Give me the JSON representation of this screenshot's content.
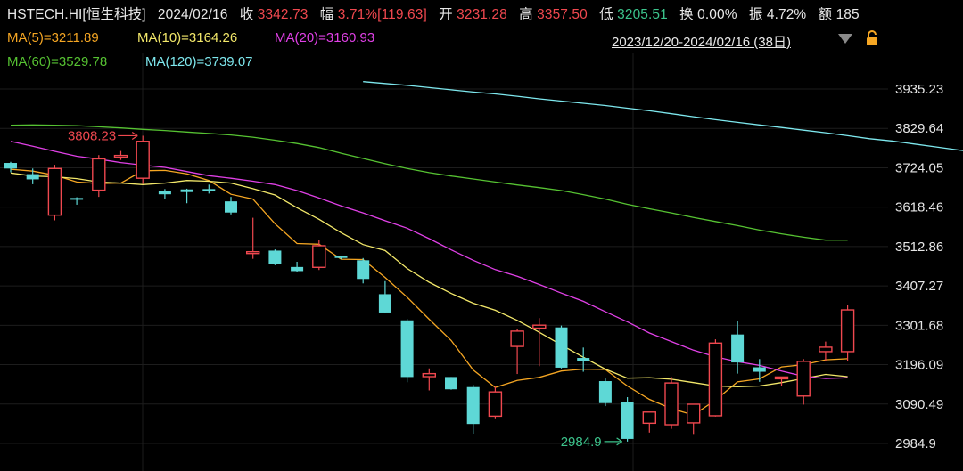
{
  "header": {
    "symbol": "HSTECH.HI[恒生科技]",
    "date": "2024/02/16",
    "close_label": "收",
    "close_value": "3342.73",
    "amp_label": "幅",
    "amp_value": "3.71%[119.63]",
    "open_label": "开",
    "open_value": "3231.28",
    "high_label": "高",
    "high_value": "3357.50",
    "low_label": "低",
    "low_value": "3205.51",
    "turnover_label": "换",
    "turnover_value": "0.00%",
    "swing_label": "振",
    "swing_value": "4.72%",
    "amount_label": "额",
    "amount_value": "185"
  },
  "indicators": {
    "ma5": "MA(5)=3211.89",
    "ma10": "MA(10)=3164.26",
    "ma20": "MA(20)=3160.93",
    "ma60": "MA(60)=3529.78",
    "ma120": "MA(120)=3739.07"
  },
  "range_label": "2023/12/20-2024/02/16 (38日)",
  "icons": [
    "dropdown-triangle-icon",
    "lock-icon"
  ],
  "colors": {
    "up": "#f0484f",
    "down": "#5ed8d6",
    "ma5": "#f5a623",
    "ma10": "#f3e86a",
    "ma20": "#e040e6",
    "ma60": "#56c232",
    "ma120": "#7ee8ee"
  },
  "chart_data": {
    "type": "candlestick",
    "y_ticks": [
      "3935.23",
      "3829.64",
      "3724.05",
      "3618.46",
      "3512.86",
      "3407.27",
      "3301.68",
      "3196.09",
      "3090.49",
      "2984.9"
    ],
    "ylim": [
      2960,
      3960
    ],
    "annotations": {
      "high_mark": "3808.23",
      "low_mark": "2984.9"
    },
    "candles": [
      {
        "o": 3737,
        "h": 3740,
        "l": 3712,
        "c": 3722
      },
      {
        "o": 3707,
        "h": 3722,
        "l": 3680,
        "c": 3693
      },
      {
        "o": 3597,
        "h": 3732,
        "l": 3583,
        "c": 3722
      },
      {
        "o": 3643,
        "h": 3645,
        "l": 3625,
        "c": 3642
      },
      {
        "o": 3664,
        "h": 3758,
        "l": 3646,
        "c": 3748
      },
      {
        "o": 3757,
        "h": 3769,
        "l": 3745,
        "c": 3757
      },
      {
        "o": 3696,
        "h": 3810,
        "l": 3681,
        "c": 3795
      },
      {
        "o": 3661,
        "h": 3667,
        "l": 3640,
        "c": 3653
      },
      {
        "o": 3666,
        "h": 3668,
        "l": 3629,
        "c": 3659
      },
      {
        "o": 3667,
        "h": 3679,
        "l": 3655,
        "c": 3662
      },
      {
        "o": 3634,
        "h": 3646,
        "l": 3599,
        "c": 3604
      },
      {
        "o": 3495,
        "h": 3590,
        "l": 3480,
        "c": 3499
      },
      {
        "o": 3502,
        "h": 3505,
        "l": 3463,
        "c": 3467
      },
      {
        "o": 3458,
        "h": 3472,
        "l": 3445,
        "c": 3447
      },
      {
        "o": 3457,
        "h": 3531,
        "l": 3450,
        "c": 3515
      },
      {
        "o": 3487,
        "h": 3488,
        "l": 3479,
        "c": 3486
      },
      {
        "o": 3476,
        "h": 3482,
        "l": 3414,
        "c": 3426
      },
      {
        "o": 3385,
        "h": 3420,
        "l": 3336,
        "c": 3336
      },
      {
        "o": 3315,
        "h": 3319,
        "l": 3149,
        "c": 3163
      },
      {
        "o": 3164,
        "h": 3186,
        "l": 3127,
        "c": 3172
      },
      {
        "o": 3163,
        "h": 3163,
        "l": 3129,
        "c": 3130
      },
      {
        "o": 3136,
        "h": 3142,
        "l": 3011,
        "c": 3037
      },
      {
        "o": 3058,
        "h": 3137,
        "l": 3050,
        "c": 3123
      },
      {
        "o": 3245,
        "h": 3292,
        "l": 3171,
        "c": 3286
      },
      {
        "o": 3294,
        "h": 3321,
        "l": 3192,
        "c": 3302
      },
      {
        "o": 3296,
        "h": 3301,
        "l": 3186,
        "c": 3188
      },
      {
        "o": 3214,
        "h": 3242,
        "l": 3177,
        "c": 3206
      },
      {
        "o": 3152,
        "h": 3159,
        "l": 3085,
        "c": 3093
      },
      {
        "o": 3096,
        "h": 3109,
        "l": 2990,
        "c": 2997
      },
      {
        "o": 3039,
        "h": 3056,
        "l": 3014,
        "c": 3069
      },
      {
        "o": 3035,
        "h": 3163,
        "l": 3024,
        "c": 3147
      },
      {
        "o": 3040,
        "h": 3071,
        "l": 3008,
        "c": 3090
      },
      {
        "o": 3059,
        "h": 3264,
        "l": 3057,
        "c": 3254
      },
      {
        "o": 3277,
        "h": 3314,
        "l": 3172,
        "c": 3202
      },
      {
        "o": 3189,
        "h": 3211,
        "l": 3150,
        "c": 3177
      },
      {
        "o": 3160,
        "h": 3163,
        "l": 3138,
        "c": 3163
      },
      {
        "o": 3112,
        "h": 3211,
        "l": 3089,
        "c": 3205
      },
      {
        "o": 3231,
        "h": 3258,
        "l": 3205,
        "c": 3243
      },
      {
        "o": 3231,
        "h": 3357,
        "l": 3205,
        "c": 3343
      }
    ],
    "series": [
      {
        "name": "MA(5)",
        "color": "#f5a623",
        "values": [
          3720,
          3715,
          3704,
          3686,
          3682,
          3683,
          3716,
          3717,
          3708,
          3690,
          3653,
          3640,
          3574,
          3521,
          3519,
          3479,
          3478,
          3430,
          3377,
          3318,
          3261,
          3182,
          3135,
          3154,
          3162,
          3179,
          3184,
          3183,
          3139,
          3103,
          3078,
          3061,
          3101,
          3150,
          3158,
          3190,
          3196,
          3209,
          3212
        ]
      },
      {
        "name": "MA(10)",
        "color": "#f3e86a",
        "values": [
          3710,
          3702,
          3700,
          3695,
          3686,
          3683,
          3679,
          3683,
          3690,
          3688,
          3683,
          3668,
          3651,
          3617,
          3586,
          3550,
          3518,
          3502,
          3454,
          3417,
          3387,
          3361,
          3342,
          3315,
          3283,
          3249,
          3216,
          3184,
          3160,
          3161,
          3157,
          3148,
          3139,
          3137,
          3139,
          3148,
          3159,
          3170,
          3164
        ]
      },
      {
        "name": "MA(20)",
        "color": "#e040e6",
        "values": [
          3795,
          3782,
          3768,
          3755,
          3747,
          3738,
          3731,
          3725,
          3714,
          3703,
          3696,
          3688,
          3679,
          3663,
          3643,
          3622,
          3603,
          3582,
          3562,
          3534,
          3504,
          3476,
          3451,
          3433,
          3411,
          3388,
          3366,
          3338,
          3311,
          3281,
          3258,
          3235,
          3217,
          3204,
          3194,
          3179,
          3165,
          3159,
          3161
        ]
      },
      {
        "name": "MA(60)",
        "color": "#56c232",
        "values": [
          3838,
          3839,
          3838,
          3837,
          3834,
          3831,
          3827,
          3824,
          3820,
          3816,
          3812,
          3806,
          3798,
          3789,
          3778,
          3763,
          3749,
          3735,
          3722,
          3711,
          3702,
          3694,
          3686,
          3678,
          3671,
          3663,
          3652,
          3640,
          3626,
          3614,
          3603,
          3591,
          3580,
          3569,
          3557,
          3547,
          3538,
          3530,
          3530
        ]
      },
      {
        "name": "MA(120)",
        "color": "#7ee8ee",
        "start_index": 16,
        "values": [
          3955,
          3950,
          3945,
          3939,
          3933,
          3927,
          3922,
          3916,
          3909,
          3903,
          3897,
          3891,
          3884,
          3877,
          3869,
          3861,
          3853,
          3846,
          3839,
          3832,
          3825,
          3818,
          3810,
          3802,
          3796,
          3788,
          3780,
          3772,
          3765,
          3758,
          3752,
          3746,
          3741,
          3739
        ]
      }
    ]
  }
}
